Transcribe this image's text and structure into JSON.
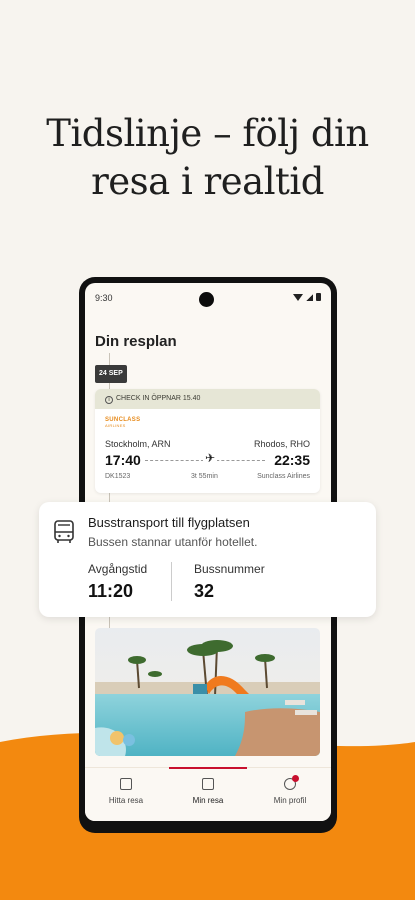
{
  "headline": {
    "line1": "Tidslinje – följ din",
    "line2": "resa i realtid"
  },
  "colors": {
    "accent_orange": "#f3890f",
    "background": "#f7f4ef",
    "nav_active": "#c8102e"
  },
  "status_bar": {
    "time": "9:30"
  },
  "screen": {
    "title": "Din resplan",
    "date_badge": "24 SEP",
    "checkin": "CHECK IN ÖPPNAR 15.40",
    "flight": {
      "logo": "SUNCLASS",
      "logo_sub": "AIRLINES",
      "from": "Stockholm, ARN",
      "to": "Rhodos, RHO",
      "depart_time": "17:40",
      "arrive_time": "22:35",
      "flight_no": "DK1523",
      "duration": "3t 55min",
      "airline": "Sunclass Airlines"
    }
  },
  "bus_card": {
    "icon": "bus-icon",
    "title": "Busstransport till flygplatsen",
    "subtitle": "Bussen stannar utanför hotellet.",
    "departure_label": "Avgångstid",
    "departure_value": "11:20",
    "bus_label": "Bussnummer",
    "bus_value": "32"
  },
  "nav": {
    "items": [
      {
        "label": "Hitta resa",
        "icon": "map-search-icon"
      },
      {
        "label": "Min resa",
        "icon": "document-icon"
      },
      {
        "label": "Min profil",
        "icon": "profile-icon"
      }
    ]
  }
}
